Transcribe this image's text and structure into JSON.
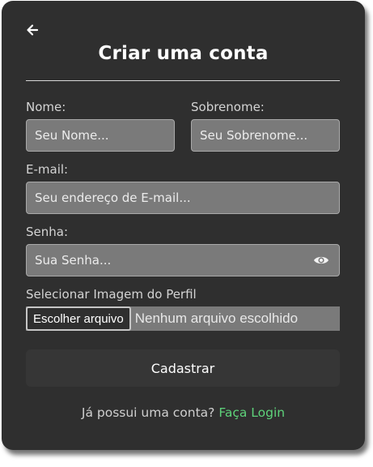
{
  "header": {
    "back_icon": "arrow-left-icon",
    "title": "Criar uma conta"
  },
  "form": {
    "first_name": {
      "label": "Nome:",
      "placeholder": "Seu Nome..."
    },
    "last_name": {
      "label": "Sobrenome:",
      "placeholder": "Seu Sobrenome..."
    },
    "email": {
      "label": "E-mail:",
      "placeholder": "Seu endereço de E-mail..."
    },
    "password": {
      "label": "Senha:",
      "placeholder": "Sua Senha...",
      "toggle_icon": "eye-icon"
    },
    "profile_image": {
      "label": "Selecionar Imagem do Perfil",
      "button_label": "Escolher arquivo",
      "status_text": "Nenhum arquivo escolhido"
    },
    "submit_label": "Cadastrar"
  },
  "footer": {
    "prompt": "Já possui uma conta?",
    "link_label": "Faça Login"
  },
  "colors": {
    "card_background": "#2f2f2f",
    "input_background": "#7a7a7a",
    "link": "#5ed27a"
  }
}
